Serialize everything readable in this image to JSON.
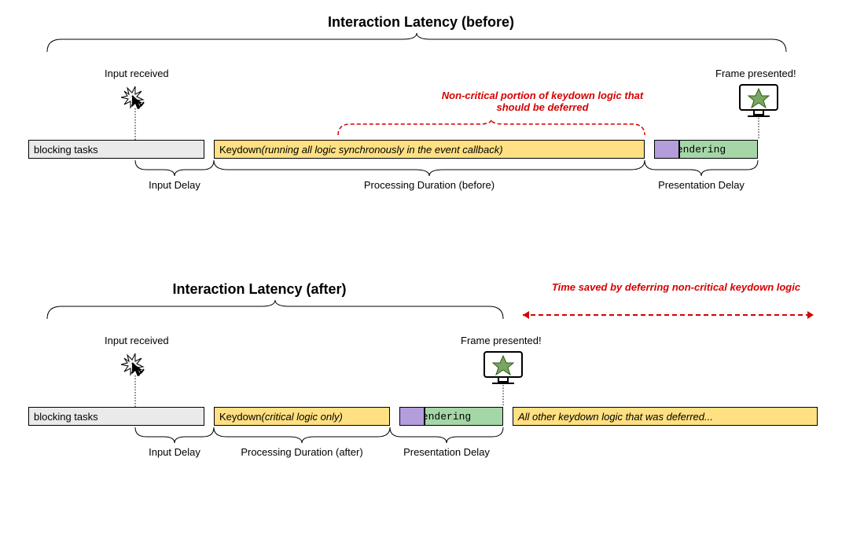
{
  "before": {
    "title": "Interaction Latency (before)",
    "input_received": "Input received",
    "frame_presented": "Frame presented!",
    "red_note": "Non-critical portion of keydown logic that should be deferred",
    "tasks": {
      "blocking": "blocking tasks",
      "keydown_prefix": "Keydown ",
      "keydown_italic": "(running all logic synchronously in the event callback)",
      "rendering": "rendering"
    },
    "spans": {
      "input_delay": "Input Delay",
      "processing": "Processing Duration (before)",
      "presentation": "Presentation Delay"
    }
  },
  "after": {
    "title": "Interaction Latency (after)",
    "input_received": "Input received",
    "frame_presented": "Frame presented!",
    "red_note": "Time saved by deferring non-critical keydown logic",
    "tasks": {
      "blocking": "blocking tasks",
      "keydown_prefix": "Keydown ",
      "keydown_italic": "(critical logic only)",
      "rendering": "rendering",
      "deferred": "All other keydown logic that was deferred..."
    },
    "spans": {
      "input_delay": "Input Delay",
      "processing": "Processing Duration (after)",
      "presentation": "Presentation Delay"
    }
  }
}
